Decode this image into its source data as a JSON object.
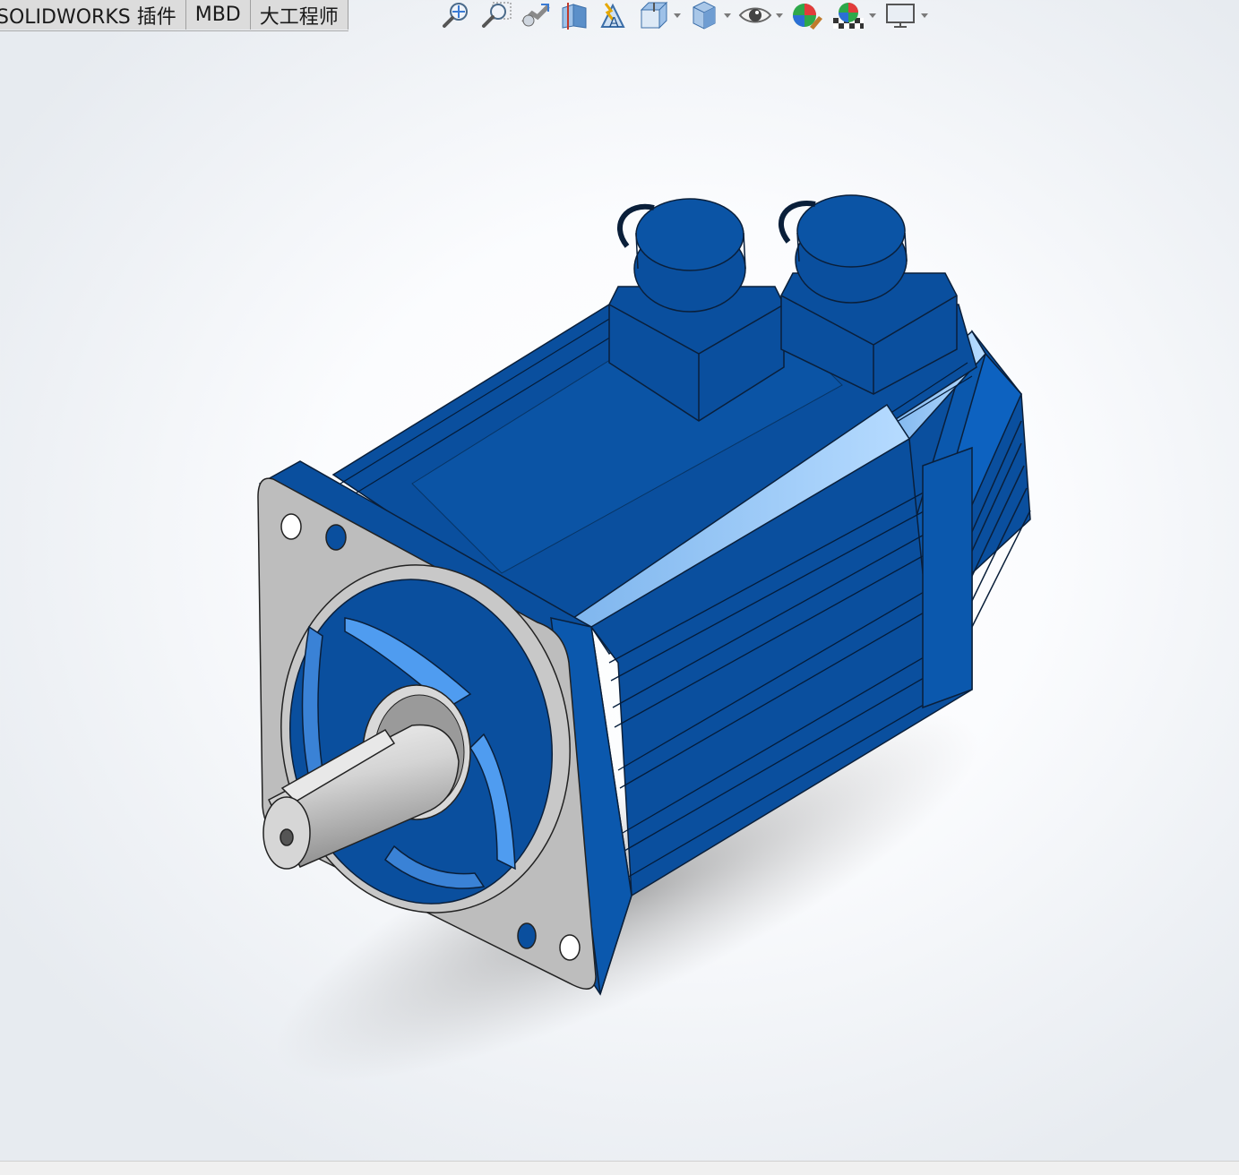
{
  "command_tabs": [
    {
      "label": "SOLIDWORKS 插件"
    },
    {
      "label": "MBD"
    },
    {
      "label": "大工程师"
    }
  ],
  "heads_up_toolbar": [
    {
      "icon": "zoom-to-fit-icon"
    },
    {
      "icon": "zoom-to-area-icon"
    },
    {
      "icon": "previous-view-icon"
    },
    {
      "icon": "section-view-icon"
    },
    {
      "icon": "dynamic-annotation-views-icon"
    },
    {
      "icon": "view-orientation-icon",
      "dropdown": true
    },
    {
      "icon": "display-style-icon",
      "dropdown": true
    },
    {
      "icon": "hide-show-items-icon",
      "dropdown": true
    },
    {
      "icon": "edit-appearance-icon"
    },
    {
      "icon": "apply-scene-icon",
      "dropdown": true
    },
    {
      "icon": "view-settings-icon",
      "dropdown": true
    }
  ],
  "model": {
    "description": "servo-motor-3d-model",
    "body_color": "#0a4f9e",
    "flange_color": "#bdbdbd"
  }
}
